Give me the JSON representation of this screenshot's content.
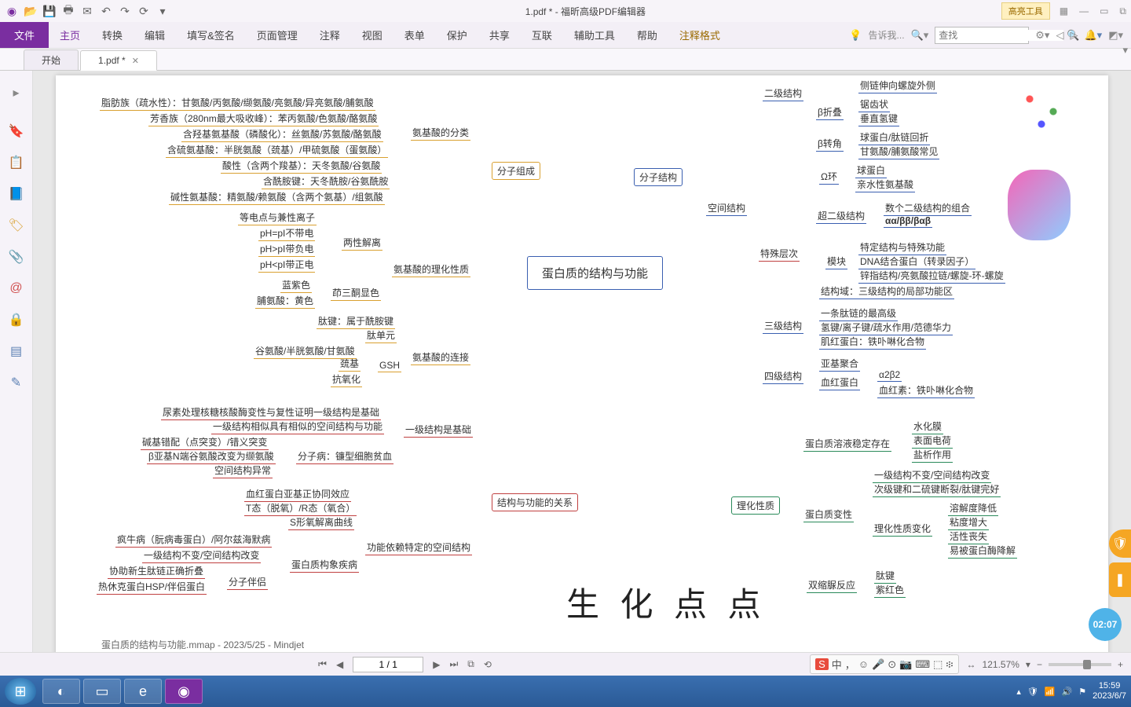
{
  "titlebar": {
    "title": "1.pdf * - 福昕高级PDF编辑器",
    "highlight_tool": "高亮工具"
  },
  "ribbon": {
    "file": "文件",
    "tabs": [
      "主页",
      "转换",
      "编辑",
      "填写&签名",
      "页面管理",
      "注释",
      "视图",
      "表单",
      "保护",
      "共享",
      "互联",
      "辅助工具",
      "帮助",
      "注释格式"
    ],
    "tell": "告诉我...",
    "search_placeholder": "查找"
  },
  "doctabs": {
    "t1": "开始",
    "t2": "1.pdf *"
  },
  "leftrail_icons": [
    "bookmark",
    "clipboard",
    "book",
    "tag",
    "clip",
    "at",
    "lock",
    "panel",
    "sign"
  ],
  "document": {
    "center": "蛋白质的结构与功能",
    "mol_comp": "分子组成",
    "mol_struct": "分子结构",
    "space_struct": "空间结构",
    "aa_class": "氨基酸的分类",
    "aa_phys": "氨基酸的理化性质",
    "aa_link": "氨基酸的连接",
    "struct_func": "结构与功能的关系",
    "phys_prop": "理化性质",
    "left": {
      "l1": "脂肪族（疏水性）：甘氨酸/丙氨酸/缬氨酸/亮氨酸/异亮氨酸/脯氨酸",
      "l2": "芳香族（280nm最大吸收峰）：苯丙氨酸/色氨酸/酪氨酸",
      "l3": "含羟基氨基酸（磷酸化）：丝氨酸/苏氨酸/酪氨酸",
      "l4": "含硫氨基酸：半胱氨酸（巯基）/甲硫氨酸（蛋氨酸）",
      "l5": "酸性（含两个羧基）：天冬氨酸/谷氨酸",
      "l6": "含酰胺键：天冬酰胺/谷氨酰胺",
      "l7": "碱性氨基酸：精氨酸/赖氨酸（含两个氨基）/组氨酸",
      "iso": "等电点与兼性离子",
      "ph1": "pH=pI不带电",
      "ph2": "pH>pI带负电",
      "ph3": "pH<pI带正电",
      "amph": "两性解离",
      "blue": "蓝紫色",
      "yellow": "脯氨酸：黄色",
      "nin": "茚三酮显色",
      "pep1": "肽键：属于酰胺键",
      "pep2": "肽单元",
      "glu": "谷氨酸/半胱氨酸/甘氨酸",
      "thiol": "巯基",
      "gsh": "GSH",
      "antiox": "抗氧化",
      "p1": "尿素处理核糖核酸酶变性与复性证明一级结构是基础",
      "p2": "一级结构相似具有相似的空间结构与功能",
      "p3": "碱基错配（点突变）/错义突变",
      "p4": "β亚基N端谷氨酸改变为缬氨酸",
      "p5": "空间结构异常",
      "sickle": "分子病：镰型细胞贫血",
      "primary": "一级结构是基础",
      "coop": "血红蛋白亚基正协同效应",
      "tr": "T态（脱氧）/R态（氧合）",
      "scurve": "S形氧解离曲线",
      "spatial": "功能依赖特定的空间结构",
      "prion": "疯牛病（朊病毒蛋白）/阿尔兹海默病",
      "conf": "蛋白质构象疾病",
      "nc1": "一级结构不变/空间结构改变",
      "fold": "协助新生肽链正确折叠",
      "chap": "分子伴侣",
      "hsp": "热休克蛋白HSP/伴侣蛋白"
    },
    "right": {
      "sec": "二级结构",
      "ter": "三级结构",
      "qua": "四级结构",
      "helix": "侧链伸向螺旋外侧",
      "bfold": "β折叠",
      "saw": "锯齿状",
      "vh": "垂直氢键",
      "bturn": "β转角",
      "glob": "球蛋白/肽链回折",
      "gly": "甘氨酸/脯氨酸常见",
      "omega": "Ω环",
      "glob2": "球蛋白",
      "hydro": "亲水性氨基酸",
      "super": "超二级结构",
      "combo": "数个二级结构的组合",
      "motif": "αα/ββ/βαβ",
      "special": "特殊层次",
      "spec1": "特定结构与特殊功能",
      "module": "模块",
      "dna": "DNA结合蛋白（转录因子）",
      "zinc": "锌指结构/亮氨酸拉链/螺旋-环-螺旋",
      "domain": "结构域：三级结构的局部功能区",
      "chain": "一条肽链的最高级",
      "bond": "氢键/离子键/疏水作用/范德华力",
      "mb": "肌红蛋白：铁卟啉化合物",
      "sub": "亚基聚合",
      "hb": "血红蛋白",
      "a2b2": "α2β2",
      "heme": "血红素：铁卟啉化合物",
      "sol": "蛋白质溶液稳定存在",
      "hyd": "水化膜",
      "chg": "表面电荷",
      "salt": "盐析作用",
      "denat": "蛋白质变性",
      "r1": "一级结构不变/空间结构改变",
      "r2": "次级键和二硫键断裂/肽键完好",
      "change": "理化性质变化",
      "c1": "溶解度降低",
      "c2": "粘度增大",
      "c3": "活性丧失",
      "c4": "易被蛋白酶降解",
      "biuret": "双缩脲反应",
      "pk": "肽键",
      "purple": "紫红色"
    },
    "footer": "蛋白质的结构与功能.mmap - 2023/5/25 - Mindjet",
    "watermark": "生 化 点 点",
    "timebubble": "02:07"
  },
  "statusbar": {
    "page": "1 / 1",
    "zoom": "121.57%"
  },
  "ime": [
    "S",
    "中",
    "，",
    "☺",
    "🎤",
    "⊙",
    "📷",
    "⌨",
    "⬚",
    "፨"
  ],
  "taskbar": {
    "time": "15:59",
    "date": "2023/6/7"
  }
}
